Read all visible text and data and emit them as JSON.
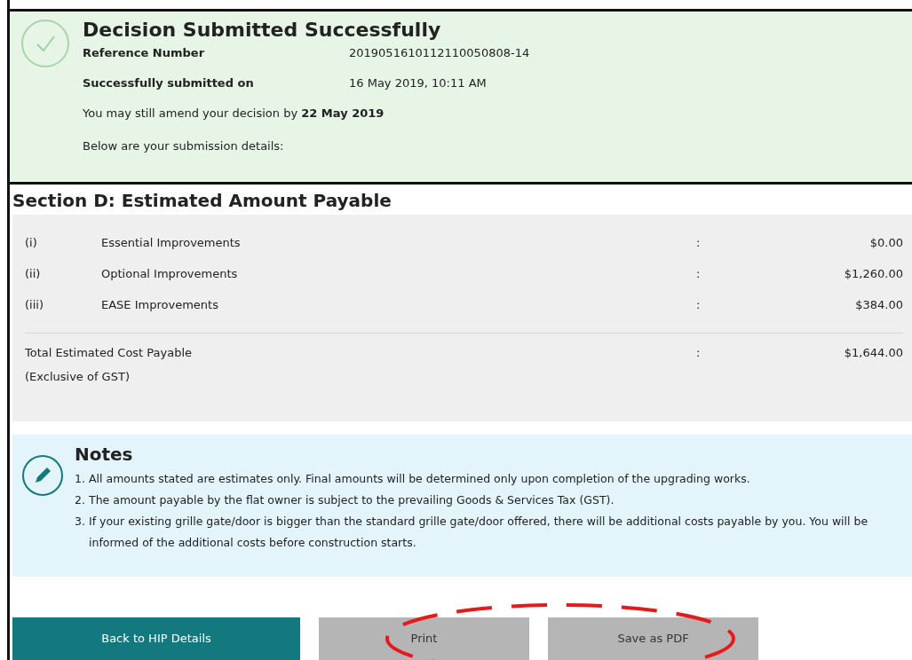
{
  "confirmation": {
    "title": "Decision Submitted Successfully",
    "fields": [
      {
        "label": "Reference Number",
        "value": "2019051610112110050808-14"
      },
      {
        "label": "Successfully submitted on",
        "value": "16 May 2019, 10:11 AM"
      }
    ],
    "amend_note": "You may still amend your decision by **22 May 2019**",
    "details_note": "Below are your submission details:"
  },
  "section": {
    "title": "Section D: Estimated Amount Payable",
    "rows": [
      {
        "index": "(i)",
        "label": "Essential Improvements",
        "separator": ":",
        "amount": "$0.00"
      },
      {
        "index": "(ii)",
        "label": "Optional Improvements",
        "separator": ":",
        "amount": "$1,260.00"
      },
      {
        "index": "(iii)",
        "label": "EASE Improvements",
        "separator": ":",
        "amount": "$384.00"
      }
    ],
    "total": {
      "label": "Total Estimated Cost Payable",
      "sublabel": "(Exclusive of GST)",
      "separator": ":",
      "amount": "$1,644.00"
    }
  },
  "notes": {
    "title": "Notes",
    "items": [
      {
        "number": "1.",
        "text": "All amounts stated are estimates only. Final amounts will be determined only upon completion of the upgrading works."
      },
      {
        "number": "2.",
        "text": "The amount payable by the flat owner is subject to the prevailing Goods & Services Tax (GST)."
      },
      {
        "number": "3.",
        "text": "If your existing grille gate/door is bigger than the standard grille gate/door offered, there will be additional costs payable by you. You will be informed of the additional costs before construction starts."
      }
    ]
  },
  "buttons": [
    {
      "label": "Back to HIP Details",
      "kind": "primary"
    },
    {
      "label": "Print",
      "kind": "secondary"
    },
    {
      "label": "Save as PDF",
      "kind": "secondary"
    }
  ]
}
